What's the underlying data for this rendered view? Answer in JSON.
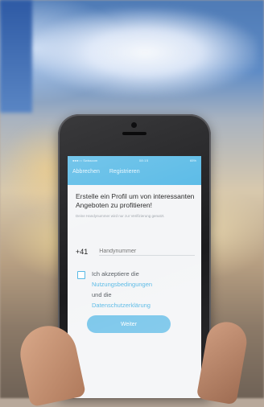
{
  "status_bar": {
    "carrier": "●●●○○ Swisscom",
    "time": "08:15",
    "battery": "65%"
  },
  "nav": {
    "cancel_label": "Abbrechen",
    "register_label": "Registrieren"
  },
  "signup": {
    "headline": "Erstelle ein Profil um von interessanten Angeboten zu profitieren!",
    "subtext": "Deine Handynummer wird nur zur Verifizierung genutzt.",
    "country_code": "+41",
    "phone_placeholder": "Handynummer",
    "terms_prefix": "Ich akzeptiere die",
    "terms_link": "Nutzungsbedingungen",
    "terms_middle": "und die",
    "privacy_link": "Datenschutzerklärung",
    "terms_accepted": false,
    "continue_label": "Weiter"
  },
  "colors": {
    "accent": "#56b9e6",
    "button": "#77c5ea"
  }
}
